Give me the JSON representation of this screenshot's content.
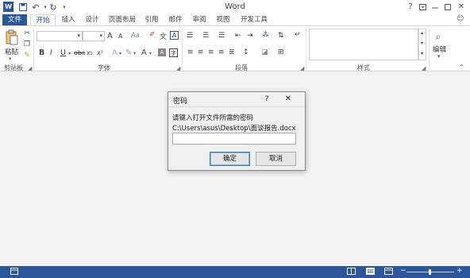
{
  "app": {
    "title": "Word",
    "help": "?",
    "account_icon": "account-icon"
  },
  "quick_access": {
    "word_icon": "word-logo-icon",
    "save_icon": "save-icon",
    "undo_icon": "undo-icon",
    "redo_icon": "redo-icon",
    "customize_icon": "customize-quick-access-icon"
  },
  "tabs": [
    {
      "label": "文件"
    },
    {
      "label": "开始"
    },
    {
      "label": "插入"
    },
    {
      "label": "设计"
    },
    {
      "label": "页面布局"
    },
    {
      "label": "引用"
    },
    {
      "label": "邮件"
    },
    {
      "label": "审阅"
    },
    {
      "label": "视图"
    },
    {
      "label": "开发工具"
    }
  ],
  "ribbon": {
    "clipboard": {
      "paste_label": "粘贴",
      "group_label": "剪贴板"
    },
    "font": {
      "font_name": "",
      "font_size": "",
      "bold": "B",
      "italic": "I",
      "underline": "U",
      "strikethrough": "abc",
      "subscript": "x₂",
      "superscript": "x²",
      "grow": "A",
      "shrink": "A",
      "change_case": "Aa",
      "font_color": "A",
      "group_label": "字体"
    },
    "paragraph": {
      "group_label": "段落"
    },
    "styles": {
      "group_label": "样式"
    },
    "editing": {
      "label": "编辑"
    }
  },
  "dialog": {
    "title": "密码",
    "help": "?",
    "close": "✕",
    "prompt": "请键入打开文件所需的密码",
    "file_path": "C:\\Users\\asus\\Desktop\\面谈报告.docx",
    "password_value": "",
    "ok_label": "确定",
    "cancel_label": "取消"
  },
  "colors": {
    "brand": "#2b579a",
    "dialog_bg": "#f0f0f0",
    "ribbon_bg": "#ffffff",
    "doc_bg": "#f3f3f3"
  }
}
